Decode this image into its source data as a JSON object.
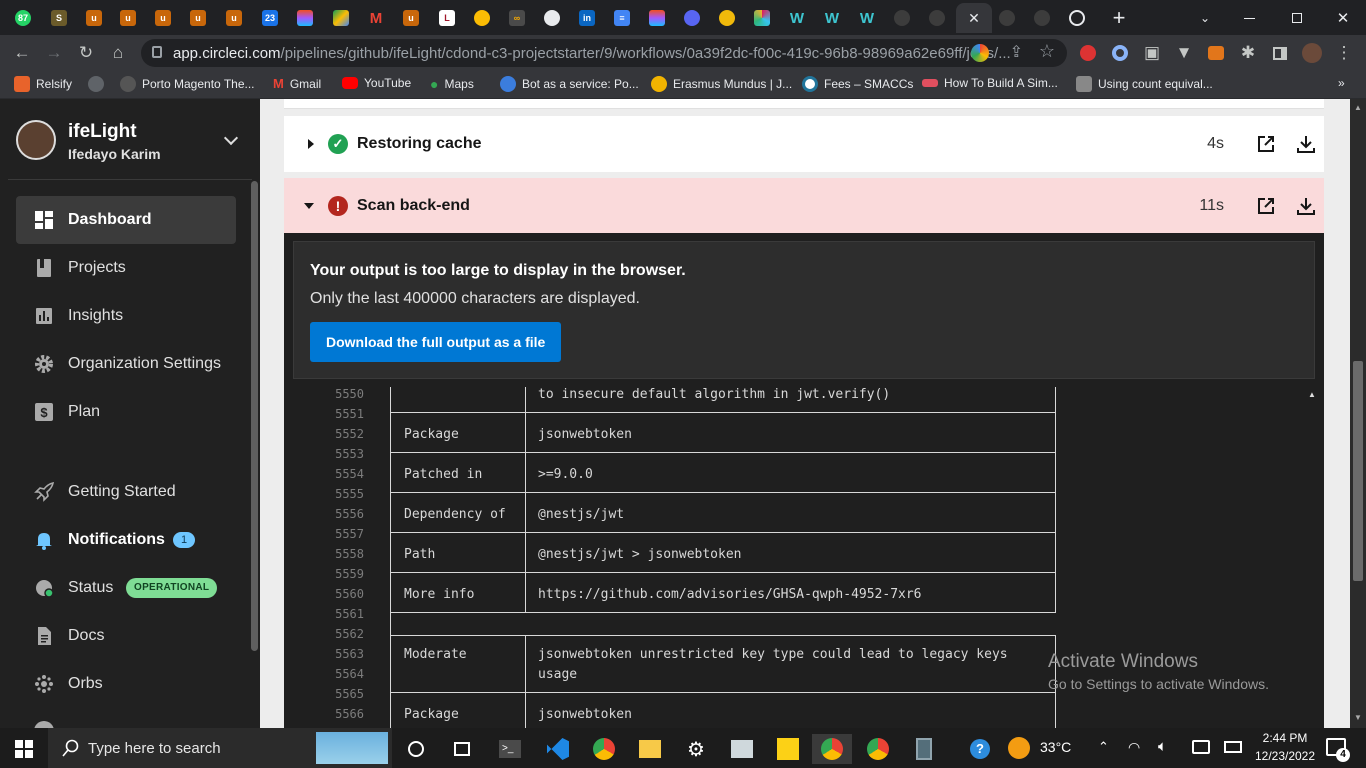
{
  "browser": {
    "url_host": "app.circleci.com",
    "url_path": "/pipelines/github/ifeLight/cdond-c3-projectstarter/9/workflows/0a39f2dc-f00c-419c-96b8-98969a62e69ff/jobs/...",
    "tab_badge": "87",
    "calendar_badge": "23",
    "tab_close": "✕",
    "new_tab": "+"
  },
  "bookmarks": [
    {
      "label": "Relsify",
      "color": "#e8632b"
    },
    {
      "label": "",
      "color": "#5f6368"
    },
    {
      "label": "Porto Magento The...",
      "color": "#555"
    },
    {
      "label": "Gmail",
      "color": "#ea4335"
    },
    {
      "label": "YouTube",
      "color": "#ff0000"
    },
    {
      "label": "Maps",
      "color": "#34a853"
    },
    {
      "label": "Bot as a service: Po...",
      "color": "#3b7ddd"
    },
    {
      "label": "Erasmus Mundus | J...",
      "color": "#f2b400"
    },
    {
      "label": "Fees – SMACCs",
      "color": "#21759b"
    },
    {
      "label": "How To Build A Sim...",
      "color": "#e04f5f"
    },
    {
      "label": "Using count equival...",
      "color": "#888"
    }
  ],
  "sidebar": {
    "org_name": "ifeLight",
    "user_name": "Ifedayo Karim",
    "items": [
      {
        "label": "Dashboard"
      },
      {
        "label": "Projects"
      },
      {
        "label": "Insights"
      },
      {
        "label": "Organization Settings"
      },
      {
        "label": "Plan"
      },
      {
        "label": "Getting Started"
      },
      {
        "label": "Notifications",
        "badge": "1"
      },
      {
        "label": "Status",
        "badge": "OPERATIONAL"
      },
      {
        "label": "Docs"
      },
      {
        "label": "Orbs"
      }
    ]
  },
  "steps": [
    {
      "title": "Restoring cache",
      "duration": "4s",
      "status": "success"
    },
    {
      "title": "Scan back-end",
      "duration": "11s",
      "status": "failed"
    }
  ],
  "output_notice": {
    "title": "Your output is too large to display in the browser.",
    "subtitle": "Only the last 400000 characters are displayed.",
    "button": "Download the full output as a file"
  },
  "log": {
    "top_line_no": "5550",
    "top_line_text": "to insecure default algorithm in jwt.verify()",
    "rows": [
      {
        "n1": "5551",
        "n2": "5552",
        "n3": "5553",
        "key": "Package",
        "value": "jsonwebtoken"
      },
      {
        "n2": "5554",
        "n3": "5555",
        "key": "Patched in",
        "value": ">=9.0.0"
      },
      {
        "n2": "5556",
        "n3": "5557",
        "key": "Dependency of",
        "value": "@nestjs/jwt"
      },
      {
        "n2": "5558",
        "n3": "5559",
        "key": "Path",
        "value": "@nestjs/jwt > jsonwebtoken"
      },
      {
        "n2": "5560",
        "n3": "5561",
        "key": "More info",
        "value": "https://github.com/advisories/GHSA-qwph-4952-7xr6"
      }
    ],
    "blank_no": "5562",
    "advisory": {
      "n1": "5563",
      "n2": "5564",
      "key": "Moderate",
      "value1": "jsonwebtoken unrestricted key type could lead to legacy keys",
      "value2": "usage"
    },
    "next_no_a": "5565",
    "next_no_b": "5566",
    "next_key": "Package",
    "next_value": "jsonwebtoken"
  },
  "watermark": {
    "title": "Activate Windows",
    "subtitle": "Go to Settings to activate Windows."
  },
  "taskbar": {
    "search_placeholder": "Type here to search",
    "weather": "33°C",
    "time": "2:44 PM",
    "date": "12/23/2022",
    "notif_count": "4"
  }
}
